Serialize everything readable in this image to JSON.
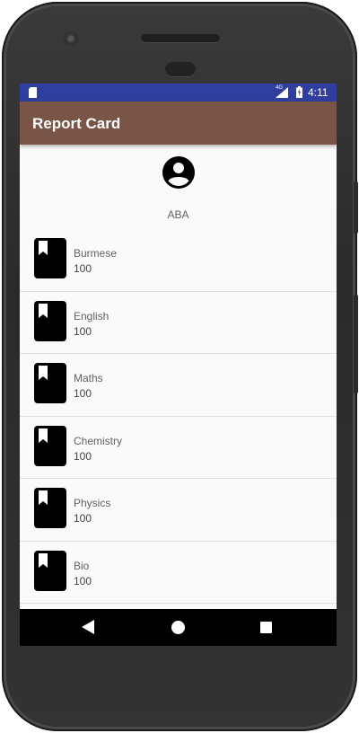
{
  "status_bar": {
    "network": "4G",
    "time": "4:11"
  },
  "app_bar": {
    "title": "Report Card"
  },
  "profile": {
    "avatar_icon": "account-circle-icon",
    "name": "ABA"
  },
  "subjects": [
    {
      "name": "Burmese",
      "score": "100",
      "icon": "bookmark-book-icon"
    },
    {
      "name": "English",
      "score": "100",
      "icon": "bookmark-book-icon"
    },
    {
      "name": "Maths",
      "score": "100",
      "icon": "bookmark-book-icon"
    },
    {
      "name": "Chemistry",
      "score": "100",
      "icon": "bookmark-book-icon"
    },
    {
      "name": "Physics",
      "score": "100",
      "icon": "bookmark-book-icon"
    },
    {
      "name": "Bio",
      "score": "100",
      "icon": "bookmark-book-icon"
    }
  ],
  "navigation": {
    "back_icon": "back-triangle-icon",
    "home_icon": "home-circle-icon",
    "recents_icon": "recents-square-icon"
  },
  "colors": {
    "status_bar": "#303f9f",
    "app_bar": "#795548",
    "background": "#fafafa"
  }
}
